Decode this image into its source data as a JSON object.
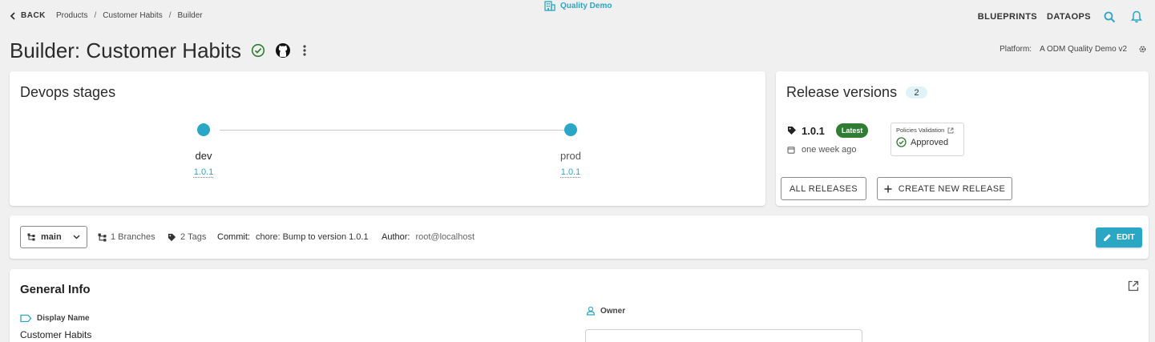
{
  "header": {
    "back_label": "BACK",
    "breadcrumbs": [
      "Products",
      "Customer Habits",
      "Builder"
    ],
    "breadcrumb_separator": "/",
    "tenant_name": "Quality Demo",
    "nav": {
      "blueprints": "BLUEPRINTS",
      "dataops": "DATAOPS"
    },
    "icons": [
      "search-icon",
      "bell-icon"
    ]
  },
  "title_row": {
    "title": "Builder: Customer Habits",
    "icons": [
      "check-circle-icon",
      "github-icon",
      "more-vertical-icon"
    ],
    "platform_label": "Platform:",
    "platform_value": "A ODM Quality Demo v2"
  },
  "devops": {
    "title": "Devops stages",
    "stages": [
      {
        "name": "dev",
        "version": "1.0.1"
      },
      {
        "name": "prod",
        "version": "1.0.1"
      }
    ]
  },
  "releases": {
    "title": "Release versions",
    "count": "2",
    "latest": {
      "version": "1.0.1",
      "badge": "Latest",
      "date": "one week ago",
      "policy_title": "Policies Validation",
      "policy_status": "Approved"
    },
    "all_releases_label": "ALL RELEASES",
    "create_label": "CREATE NEW RELEASE"
  },
  "branch_bar": {
    "branch": "main",
    "branches_count": "1",
    "branches_label": "Branches",
    "tags_count": "2",
    "tags_label": "Tags",
    "commit_label": "Commit:",
    "commit_message": "chore: Bump to version 1.0.1",
    "author_label": "Author:",
    "author": "root@localhost",
    "edit_label": "EDIT"
  },
  "general_info": {
    "title": "General Info",
    "display_name_label": "Display Name",
    "display_name_value": "Customer Habits",
    "owner_label": "Owner"
  },
  "colors": {
    "accent": "#2aa7c4",
    "success": "#2e7d32",
    "background": "#f0f0f0",
    "card": "#ffffff"
  }
}
